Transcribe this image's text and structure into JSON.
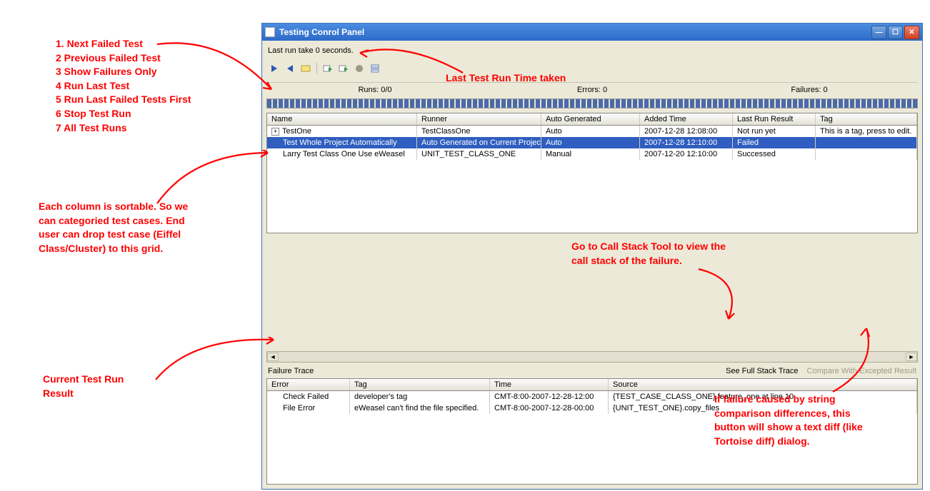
{
  "annotations": {
    "toolbar_list_1": "1. Next Failed Test",
    "toolbar_list_2": "2 Previous Failed Test",
    "toolbar_list_3": "3 Show Failures Only",
    "toolbar_list_4": "4 Run Last Test",
    "toolbar_list_5": "5 Run Last Failed Tests First",
    "toolbar_list_6": "6 Stop Test Run",
    "toolbar_list_7": "7 All Test Runs",
    "last_run_note": "Last Test Run Time taken",
    "sortable_line1": "Each column is sortable. So we",
    "sortable_line2": "can categoried test cases. End",
    "sortable_line3": "user can drop test case (Eiffel",
    "sortable_line4": "Class/Cluster) to this grid.",
    "callstack_line1": "Go to Call Stack Tool  to view the",
    "callstack_line2": "call stack of the failure.",
    "current_result_line1": "Current Test Run",
    "current_result_line2": "Result",
    "diff_line1": "If failure caused by string",
    "diff_line2": "comparison differences, this",
    "diff_line3": "button will show a text diff (like",
    "diff_line4": "Tortoise diff) dialog."
  },
  "window": {
    "title": "Testing Conrol Panel",
    "status": "Last run take 0 seconds.",
    "stats": {
      "runs": "Runs: 0/0",
      "errors": "Errors: 0",
      "failures": "Failures: 0"
    }
  },
  "test_grid": {
    "columns": {
      "name": "Name",
      "runner": "Runner",
      "auto": "Auto Generated",
      "added": "Added Time",
      "result": "Last Run Result",
      "tag": "Tag"
    },
    "rows": [
      {
        "name": "TestOne",
        "runner": "TestClassOne",
        "auto": "Auto",
        "added": "2007-12-28 12:08:00",
        "result": "Not run yet",
        "tag": "This is a tag, press to edit.",
        "expand": true,
        "selected": false
      },
      {
        "name": "Test Whole Project Automatically",
        "runner": "Auto Generated on Current Project",
        "auto": "Auto",
        "added": "2007-12-28 12:10:00",
        "result": "Failed",
        "tag": "",
        "selected": true
      },
      {
        "name": "Larry Test Class One Use eWeasel",
        "runner": "UNIT_TEST_CLASS_ONE",
        "auto": "Manual",
        "added": "2007-12-20 12:10:00",
        "result": "Successed",
        "tag": "",
        "selected": false
      }
    ]
  },
  "trace": {
    "label": "Failure Trace",
    "link_stack": "See Full Stack Trace",
    "link_compare": "Compare With Excepted Result",
    "columns": {
      "error": "Error",
      "tag": "Tag",
      "time": "Time",
      "source": "Source"
    },
    "rows": [
      {
        "error": "Check Failed",
        "tag": "developer's tag",
        "time": "CMT-8:00-2007-12-28-12:00",
        "source": "{TEST_CASE_CLASS_ONE}.feature_one at line 10"
      },
      {
        "error": "File Error",
        "tag": "eWeasel can't find the file specified.",
        "time": "CMT-8:00-2007-12-28-00:00",
        "source": "{UNIT_TEST_ONE}.copy_files"
      }
    ]
  }
}
